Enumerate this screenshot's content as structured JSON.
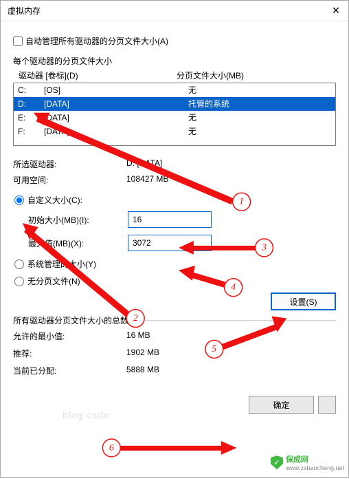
{
  "window": {
    "title": "虚拟内存"
  },
  "autoManage": {
    "label": "自动管理所有驱动器的分页文件大小(A)",
    "checked": false
  },
  "perDrive": {
    "heading": "每个驱动器的分页文件大小",
    "colDrive": "驱动器 [卷标](D)",
    "colSize": "分页文件大小(MB)"
  },
  "drives": [
    {
      "letter": "C:",
      "label": "[OS]",
      "size": "无"
    },
    {
      "letter": "D:",
      "label": "[DATA]",
      "size": "托管的系统"
    },
    {
      "letter": "E:",
      "label": "[DATA]",
      "size": "无"
    },
    {
      "letter": "F:",
      "label": "[DATA]",
      "size": "无"
    }
  ],
  "selected": {
    "driveLabel": "所选驱动器:",
    "driveValue": "D:  [DATA]",
    "spaceLabel": "可用空间:",
    "spaceValue": "108427 MB"
  },
  "custom": {
    "radioLabel": "自定义大小(C):",
    "initialLabel": "初始大小(MB)(I):",
    "initialValue": "16",
    "maxLabel": "最大值(MB)(X):",
    "maxValue": "3072"
  },
  "systemRadio": "系统管理的大小(Y)",
  "noneRadio": "无分页文件(N)",
  "setBtn": "设置(S)",
  "totals": {
    "heading": "所有驱动器分页文件大小的总数",
    "minLabel": "允许的最小值:",
    "minValue": "16 MB",
    "recLabel": "推荐:",
    "recValue": "1902 MB",
    "curLabel": "当前已分配:",
    "curValue": "5888 MB"
  },
  "okBtn": "确定",
  "watermark": {
    "site": "保成网",
    "url": "www.zsbaocheng.net"
  },
  "faint": "blog csdn"
}
